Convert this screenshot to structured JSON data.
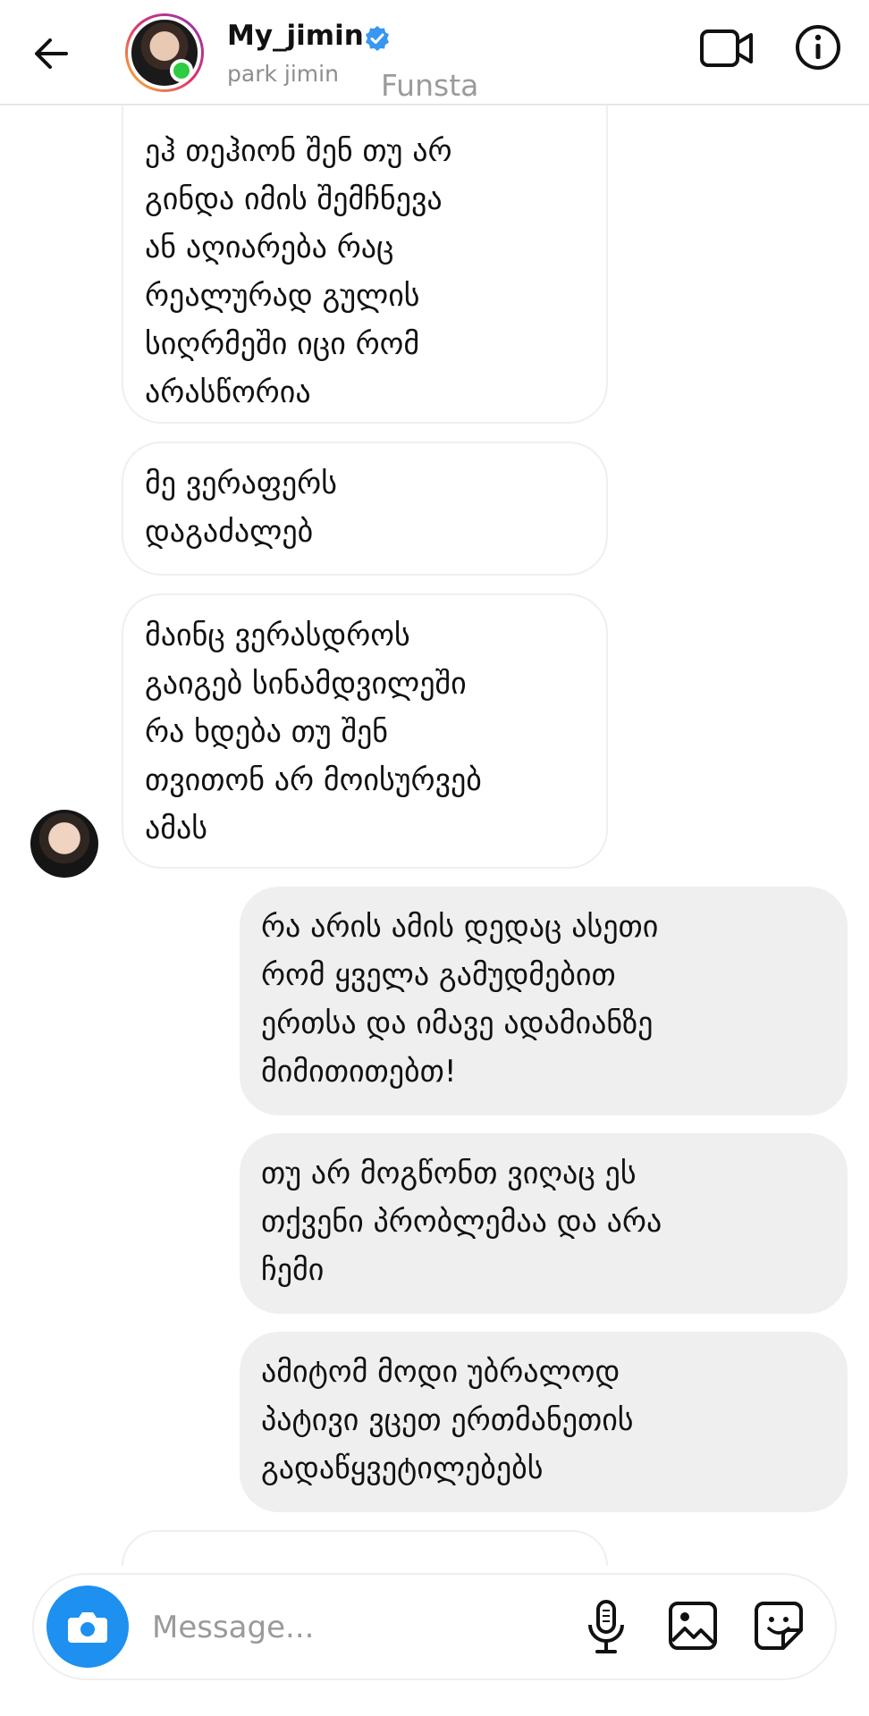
{
  "header": {
    "name": "My_jimin",
    "subtitle": "park jimin",
    "overlay_text": "Funsta",
    "icons": {
      "back": "back-arrow-icon",
      "verified": "verified-badge-icon",
      "video": "video-call-icon",
      "info": "info-icon"
    }
  },
  "messages": [
    {
      "direction": "incoming",
      "text": "ეჰ თეჰიონ შენ თუ არ\nგინდა იმის შემჩნევა\nან აღიარება რაც\nრეალურად გულის\nსიღრმეში იცი რომ\nარასწორია"
    },
    {
      "direction": "incoming",
      "text": "მე ვერაფერს\nდაგაძალებ"
    },
    {
      "direction": "incoming",
      "text": "მაინც ვერასდროს\nგაიგებ სინამდვილეში\nრა ხდება თუ შენ\nთვითონ არ მოისურვებ\nამას"
    },
    {
      "direction": "outgoing",
      "text": "რა არის ამის დედაც ასეთი\nრომ ყველა გამუდმებით\nერთსა და იმავე ადამიანზე\nმიმითითებთ!"
    },
    {
      "direction": "outgoing",
      "text": "თუ არ მოგწონთ ვიღაც ეს\nთქვენი პრობლემაა და არა\nჩემი"
    },
    {
      "direction": "outgoing",
      "text": "ამიტომ მოდი უბრალოდ\nპატივი ვცეთ ერთმანეთის\nგადაწყვეტილებებს"
    }
  ],
  "composer": {
    "placeholder": "Message...",
    "value": "",
    "icons": [
      "camera-icon",
      "microphone-icon",
      "gallery-icon",
      "sticker-icon"
    ]
  },
  "colors": {
    "accent": "#1e90ef",
    "online": "#2ecc40",
    "verified": "#3897f0",
    "outgoing_bubble": "#efefef"
  }
}
